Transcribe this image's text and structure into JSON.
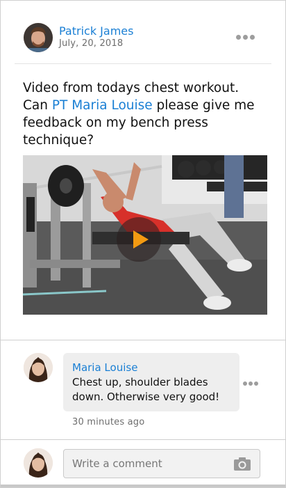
{
  "post": {
    "author_name": "Patrick James",
    "date": "July, 20, 2018",
    "text_before": "Video from todays chest workout. Can ",
    "mention": "PT Maria Louise",
    "text_after": " please give me feedback on my bench press technique?"
  },
  "video": {
    "play_icon": "play-icon",
    "play_color": "#f39a12"
  },
  "comment": {
    "author": "Maria Louise",
    "text": "Chest up, shoulder blades down. Otherwise very good!",
    "time": "30 minutes ago"
  },
  "composer": {
    "placeholder": "Write a comment",
    "camera_icon": "camera-icon"
  },
  "colors": {
    "link": "#1a7fd4",
    "muted": "#6e6e6e",
    "bubble": "#eeeeee"
  }
}
